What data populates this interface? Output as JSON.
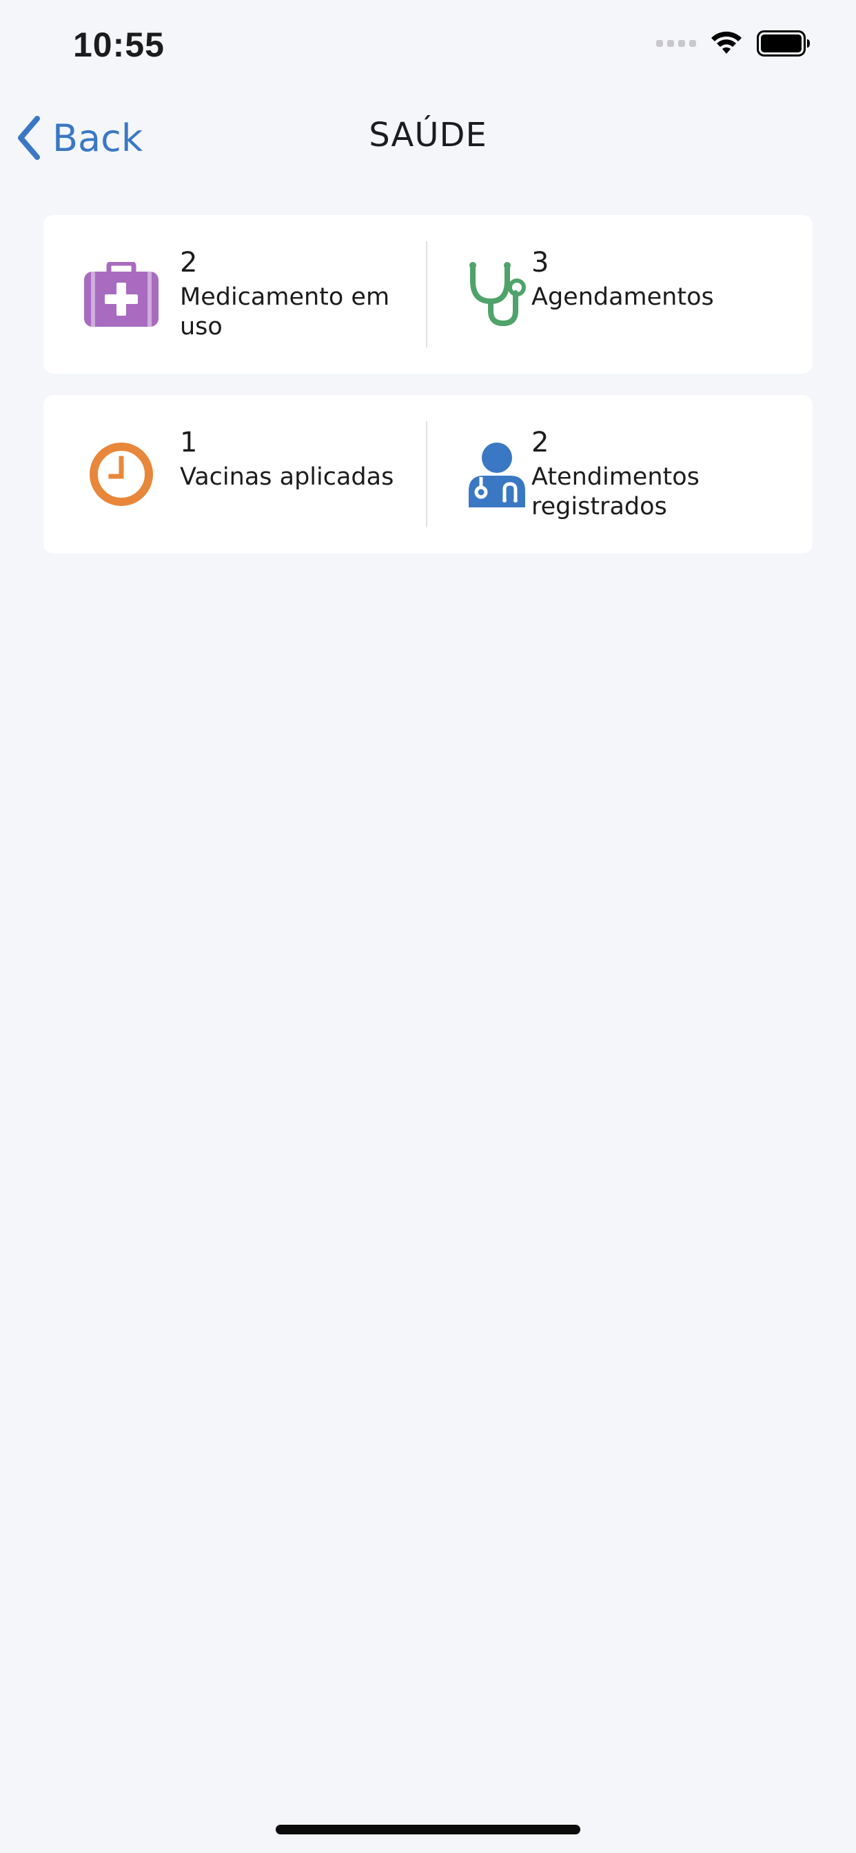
{
  "status_bar": {
    "time": "10:55"
  },
  "nav": {
    "back_label": "Back",
    "title": "SAÚDE"
  },
  "cards": [
    {
      "left": {
        "count": "2",
        "label": "Medicamento em uso",
        "icon": "first-aid-kit-icon",
        "color": "#a86bbf"
      },
      "right": {
        "count": "3",
        "label": "Agendamentos",
        "icon": "stethoscope-icon",
        "color": "#4fa36a"
      }
    },
    {
      "left": {
        "count": "1",
        "label": "Vacinas aplicadas",
        "icon": "clock-icon",
        "color": "#e8873a"
      },
      "right": {
        "count": "2",
        "label": "Atendimentos registrados",
        "icon": "doctor-icon",
        "color": "#3a78c4"
      }
    }
  ],
  "colors": {
    "accent": "#3a78c4",
    "background": "#f4f6fa"
  }
}
